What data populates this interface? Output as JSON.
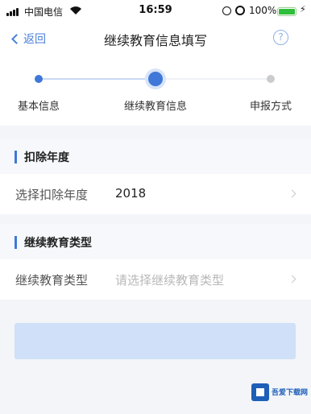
{
  "status_bar": {
    "carrier": "中国电信",
    "time": "16:59",
    "battery_percent": "100%",
    "icons": [
      "signal-icon",
      "wifi-icon",
      "rotation-lock-icon",
      "alarm-icon",
      "battery-icon",
      "charging-icon"
    ]
  },
  "nav": {
    "back_label": "返回",
    "title": "继续教育信息填写",
    "help_symbol": "?"
  },
  "steps": [
    {
      "label": "基本信息",
      "state": "done"
    },
    {
      "label": "继续教育信息",
      "state": "active"
    },
    {
      "label": "申报方式",
      "state": "pending"
    }
  ],
  "sections": {
    "deduction_year": {
      "header": "扣除年度",
      "row_label": "选择扣除年度",
      "row_value": "2018"
    },
    "education_type": {
      "header": "继续教育类型",
      "row_label": "继续教育类型",
      "row_placeholder": "请选择继续教育类型"
    }
  },
  "colors": {
    "accent": "#3f78d8",
    "button_disabled": "#cfe0f8",
    "page_bg": "#f3f5f9"
  },
  "watermark": {
    "text": "吾爱下载网"
  }
}
